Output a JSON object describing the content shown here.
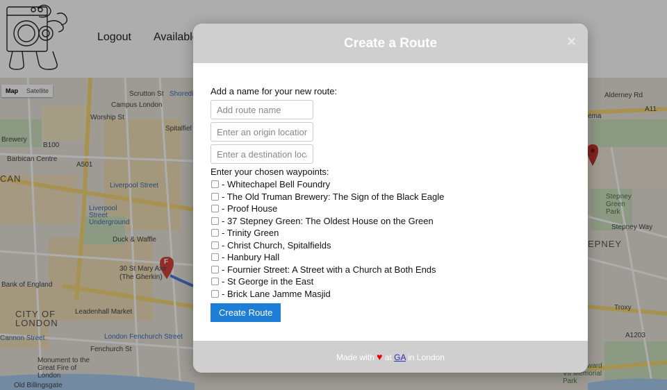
{
  "nav": {
    "logout": "Logout",
    "available": "Available"
  },
  "map": {
    "type_map": "Map",
    "type_satellite": "Satellite",
    "labels": {
      "campus": "Campus London",
      "worship": "Worship St",
      "brewery": "Brewery",
      "barbican": "Barbican Centre",
      "can": "CAN",
      "liverpool_st": "Liverpool Street",
      "liverpool_ug": "Liverpool Street Underground",
      "duck": "Duck & Waffle",
      "gherkin": "30 St Mary Axe (The Gherkin)",
      "boe": "Bank of England",
      "leadenhall": "Leadenhall Market",
      "city": "CITY OF LONDON",
      "cannon": "Cannon Street",
      "fenchurch": "London Fenchurch Street",
      "monument": "Monument to the Great Fire of London",
      "billingsgate": "Old Billingsgate",
      "scrutton": "Scrutton St",
      "shoreditch": "Shoredi",
      "spitalfields": "Spitalfiel",
      "stepney_green": "Stepney Green Park",
      "stepney_way": "Stepney Way",
      "stepney": "EPNEY",
      "troxy": "Troxy",
      "edward_vii": "King Edward VII Memorial Park",
      "alderney": "Alderney Rd",
      "a11": "A11",
      "a1203": "A1203",
      "ema": "ema",
      "b100": "B100",
      "a501": "A501",
      "fenchurch_st": "Fenchurch St",
      "marker_f": "F"
    }
  },
  "modal": {
    "title": "Create a Route",
    "close": "×",
    "intro": "Add a name for your new route:",
    "route_name_placeholder": "Add route name",
    "origin_placeholder": "Enter an origin location",
    "destination_placeholder": "Enter a destination location",
    "waypoints_label": "Enter your chosen waypoints:",
    "waypoints": [
      "- Whitechapel Bell Foundry",
      "- The Old Truman Brewery: The Sign of the Black Eagle",
      "- Proof House",
      "- 37 Stepney Green: The Oldest House on the Green",
      "- Trinity Green",
      "- Christ Church, Spitalfields",
      "- Hanbury Hall",
      "- Fournier Street: A Street with a Church at Both Ends",
      "- St George in the East",
      "- Brick Lane Jamme Masjid"
    ],
    "submit": "Create Route",
    "footer": {
      "made_with": "Made with",
      "heart": "♥",
      "at": "at",
      "link": "GA",
      "location": "in London"
    }
  },
  "colors": {
    "button": "#1e7ed6",
    "modal_header": "#cfcfcf",
    "heart": "#e00000"
  }
}
